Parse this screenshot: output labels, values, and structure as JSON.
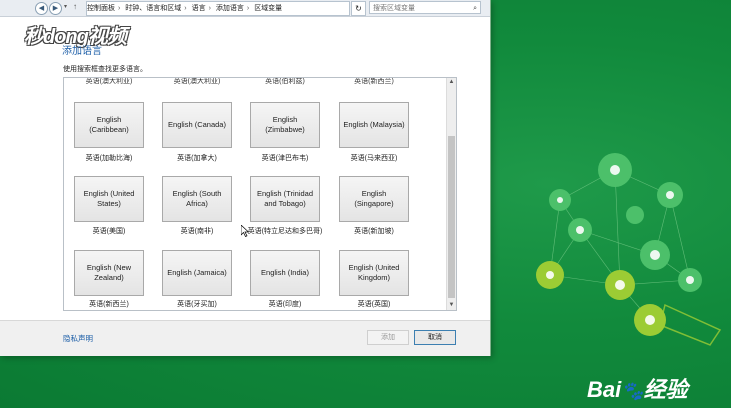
{
  "watermark": {
    "logo_text": "秒dong视频",
    "brand_text": "Bai",
    "brand_suffix": "经验"
  },
  "address_bar": {
    "crumbs": [
      "控制面板",
      "时钟、语言和区域",
      "语言",
      "添加语言",
      "区域变量"
    ],
    "search_placeholder": "搜索区域变量"
  },
  "page": {
    "title": "添加语言",
    "instruction": "使用搜索框查找更多语言。"
  },
  "top_row_labels": [
    "英语(澳大利亚)",
    "英语(澳大利亚)",
    "英语(伯利兹)",
    "英语(新西兰)"
  ],
  "tiles": [
    {
      "text": "English (Caribbean)",
      "label": "英语(加勒比海)"
    },
    {
      "text": "English (Canada)",
      "label": "英语(加拿大)"
    },
    {
      "text": "English (Zimbabwe)",
      "label": "英语(津巴布韦)"
    },
    {
      "text": "English (Malaysia)",
      "label": "英语(马来西亚)"
    },
    {
      "text": "English (United States)",
      "label": "英语(美国)"
    },
    {
      "text": "English (South Africa)",
      "label": "英语(南非)"
    },
    {
      "text": "English (Trinidad and Tobago)",
      "label": "英语(特立尼达和多巴哥)"
    },
    {
      "text": "English (Singapore)",
      "label": "英语(新加坡)"
    },
    {
      "text": "English (New Zealand)",
      "label": "英语(新西兰)"
    },
    {
      "text": "English (Jamaica)",
      "label": "英语(牙买加)"
    },
    {
      "text": "English (India)",
      "label": "英语(印度)"
    },
    {
      "text": "English (United Kingdom)",
      "label": "英语(英国)"
    }
  ],
  "footer": {
    "privacy": "隐私声明",
    "add_button": "添加",
    "cancel_button": "取消"
  }
}
